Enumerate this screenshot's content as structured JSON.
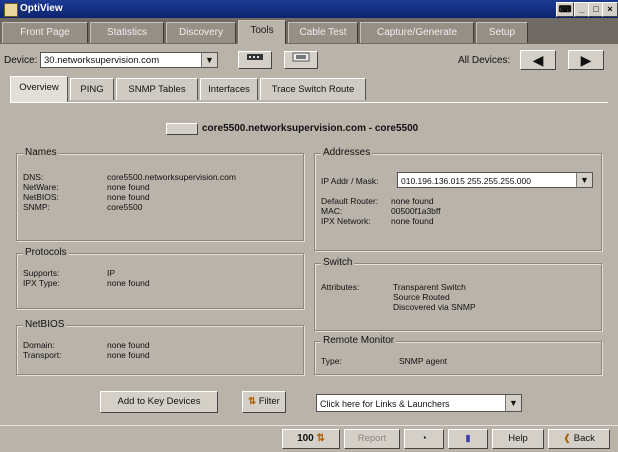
{
  "window": {
    "title": "OptiView"
  },
  "main_tabs": [
    {
      "label": "Front Page"
    },
    {
      "label": "Statistics"
    },
    {
      "label": "Discovery"
    },
    {
      "label": "Tools"
    },
    {
      "label": "Cable Test"
    },
    {
      "label": "Capture/Generate"
    },
    {
      "label": "Setup"
    }
  ],
  "device_row": {
    "device_label": "Device:",
    "device_value": "30.networksupervision.com",
    "all_devices_label": "All Devices:"
  },
  "sub_tabs": [
    {
      "label": "Overview"
    },
    {
      "label": "PING"
    },
    {
      "label": "SNMP Tables"
    },
    {
      "label": "Interfaces"
    },
    {
      "label": "Trace Switch Route"
    }
  ],
  "header": {
    "device_title": "core5500.networksupervision.com - core5500"
  },
  "names": {
    "title": "Names",
    "rows": [
      {
        "key": "DNS:",
        "value": "core5500.networksupervision.com"
      },
      {
        "key": "NetWare:",
        "value": "none found"
      },
      {
        "key": "NetBIOS:",
        "value": "none found"
      },
      {
        "key": "SNMP:",
        "value": "core5500"
      }
    ]
  },
  "protocols": {
    "title": "Protocols",
    "rows": [
      {
        "key": "Supports:",
        "value": "IP"
      },
      {
        "key": "IPX Type:",
        "value": "none found"
      }
    ]
  },
  "netbios": {
    "title": "NetBIOS",
    "rows": [
      {
        "key": "Domain:",
        "value": "none found"
      },
      {
        "key": "Transport:",
        "value": "none found"
      }
    ]
  },
  "addresses": {
    "title": "Addresses",
    "ip_label": "IP Addr / Mask:",
    "ip_value": "010.196.136.015   255.255.255.000",
    "rows": [
      {
        "key": "Default Router:",
        "value": "none found"
      },
      {
        "key": "MAC:",
        "value": "00500f1a3bff"
      },
      {
        "key": "IPX Network:",
        "value": "none found"
      }
    ]
  },
  "switch": {
    "title": "Switch",
    "key": "Attributes:",
    "values": [
      "Transparent Switch",
      "Source Routed",
      "Discovered via SNMP"
    ]
  },
  "remote_monitor": {
    "title": "Remote Monitor",
    "rows": [
      {
        "key": "Type:",
        "value": "SNMP agent"
      }
    ]
  },
  "actions": {
    "add_key_devices": "Add to Key Devices",
    "filter": "Filter",
    "links_placeholder": "Click here for Links & Launchers"
  },
  "statusbar": {
    "percent": "100",
    "report": "Report",
    "help": "Help",
    "back": "Back"
  },
  "colors": {
    "title_bar": "#1c3a94",
    "tab_bar": "#6f6a63",
    "panel_bg": "#b9b3aa"
  }
}
